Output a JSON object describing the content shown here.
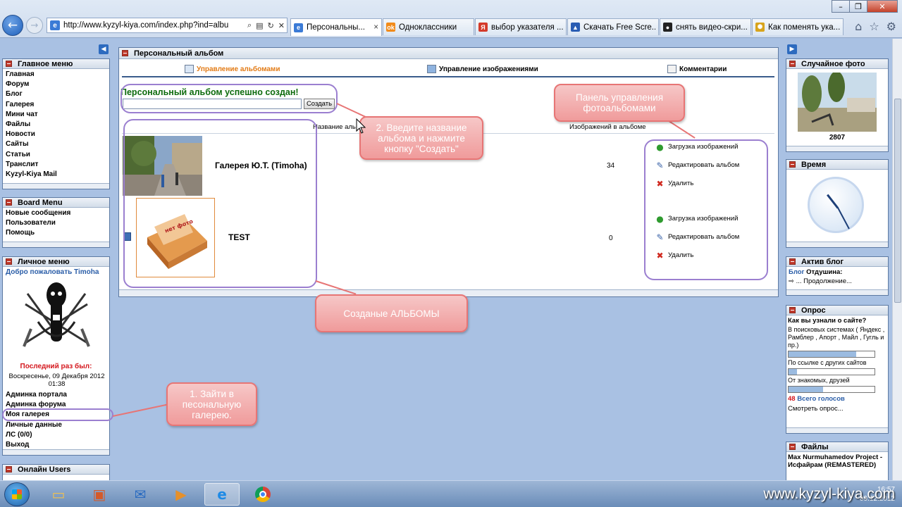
{
  "browser": {
    "url": "http://www.kyzyl-kiya.com/index.php?ind=albu",
    "tabs": [
      {
        "label": "Персональны...",
        "icon": "e",
        "color": "#3b7bd6",
        "close": "×"
      },
      {
        "label": "Одноклассники",
        "icon": "ok",
        "color": "#f28b1a"
      },
      {
        "label": "выбор указателя ...",
        "icon": "Я",
        "color": "#d43a2a"
      },
      {
        "label": "Скачать Free Scre...",
        "icon": "▲",
        "color": "#2a5db3"
      },
      {
        "label": "снять видео-скри...",
        "icon": "●",
        "color": "#222"
      },
      {
        "label": "Как поменять ука...",
        "icon": "✺",
        "color": "#d8a41c"
      }
    ]
  },
  "left": {
    "main_menu": {
      "title": "Главное меню",
      "items": [
        "Главная",
        "Форум",
        "Блог",
        "Галерея",
        "Мини чат",
        "Файлы",
        "Новости",
        "Сайты",
        "Статьи",
        "Транслит",
        "Kyzyl-Kiya Mail"
      ]
    },
    "board_menu": {
      "title": "Board Menu",
      "items": [
        "Новые сообщения",
        "Пользователи",
        "Помощь"
      ]
    },
    "personal_menu": {
      "title": "Личное меню",
      "welcome": "Добро пожаловать Timoha",
      "last_seen_label": "Последний раз был:",
      "last_seen_value": "Воскресенье, 09 Декабря 2012 01:38",
      "items": [
        "Админка портала",
        "Админка форума",
        "Моя галерея",
        "Личные данные",
        "ЛС (0/0)",
        "Выход"
      ]
    },
    "online_title": "Онлайн Users"
  },
  "album": {
    "title": "Персональный альбом",
    "tabs": [
      "Управление альбомами",
      "Управление изображениями",
      "Комментарии"
    ],
    "success": "Персональный альбом успешно создан!",
    "create_button": "Создать",
    "col_name": "Название альбома",
    "col_count": "Изображений в альбоме",
    "no_photo_label": "нет фото",
    "albums": [
      {
        "name": "Галерея Ю.Т. (Timoha)",
        "count": "34"
      },
      {
        "name": "TEST",
        "count": "0"
      }
    ],
    "actions": [
      "Загрузка изображений",
      "Редактировать альбом",
      "Удалить"
    ]
  },
  "annotations": {
    "step2": "2. Введите название альбома и нажмите кнопку \"Создать\"",
    "panel": "Панель управления фотоальбомами",
    "created": "Созданые АЛЬБОМЫ",
    "step1": "1. Зайти в песональную галерею."
  },
  "right": {
    "random_photo": {
      "title": "Случайное фото",
      "id": "2807"
    },
    "time_title": "Время",
    "blog": {
      "title": "Актив блог",
      "label": "Блог",
      "name": "Отдушина:",
      "more": "... Продолжение..."
    },
    "poll": {
      "title": "Опрос",
      "question": "Как вы узнали о сайте?",
      "options": [
        {
          "label": "В поисковых системах ( Яндекс , Рамблер , Апорт , Майл , Гугль и пр.)",
          "fraction": 0.79
        },
        {
          "label": "По ссылке с других сайтов",
          "fraction": 0.1
        },
        {
          "label": "От знакомых, друзей",
          "fraction": 0.4
        }
      ],
      "votes_count": "48",
      "votes_label": "Всего голосов",
      "view": "Смотреть опрос..."
    },
    "files": {
      "title": "Файлы",
      "entry": "Max Nurmuhamedov Project - Исфайрам (REMASTERED)"
    }
  },
  "taskbar": {
    "time": "16:57",
    "date": "09.12.2012"
  },
  "watermark": "www.kyzyl-kiya.com"
}
